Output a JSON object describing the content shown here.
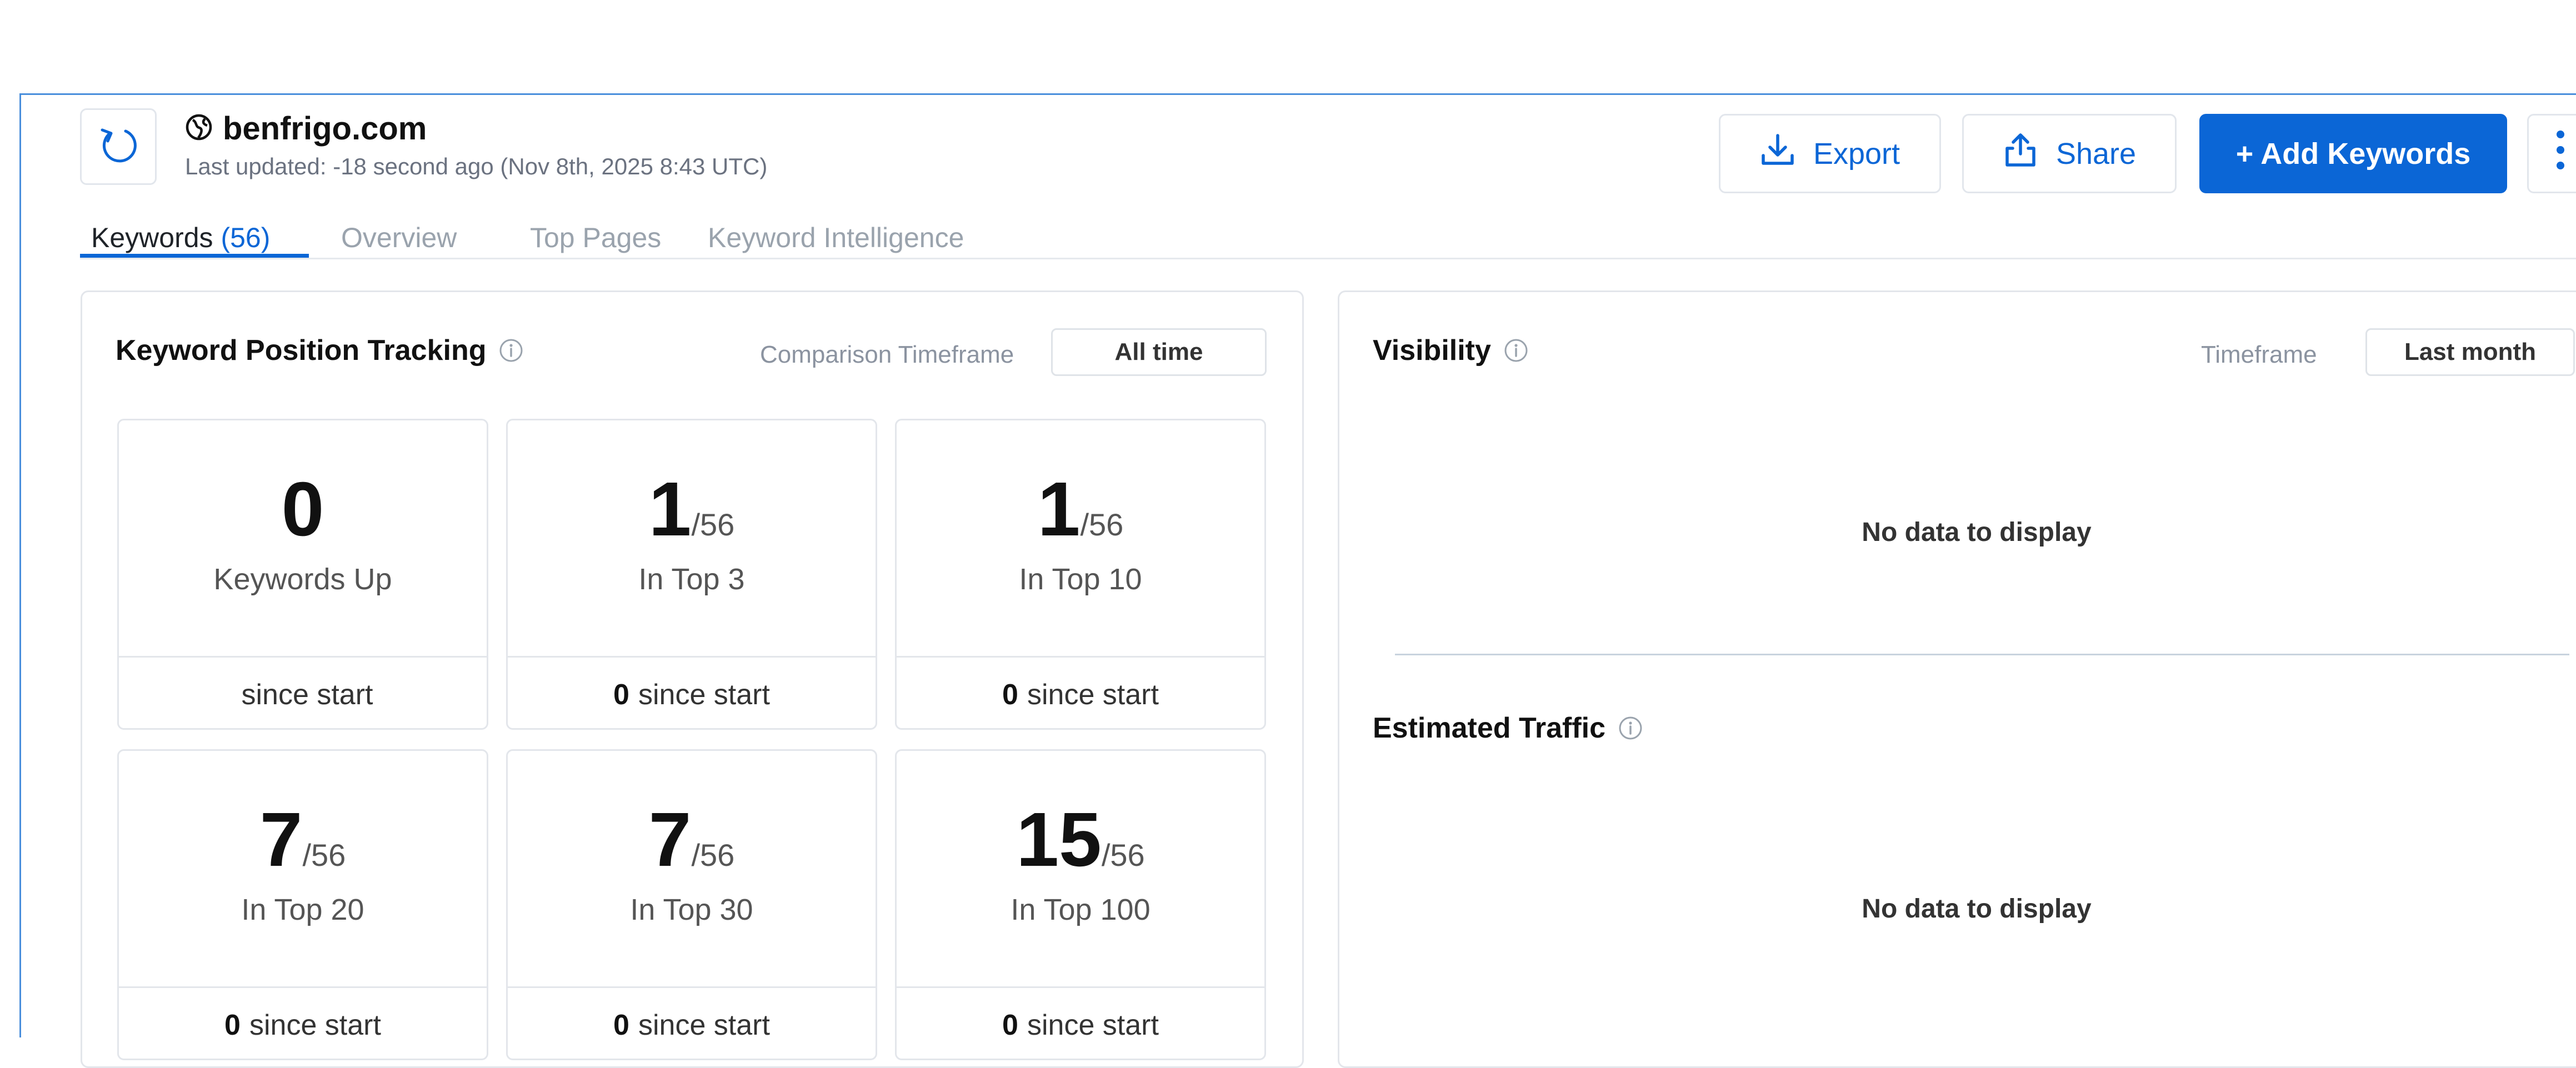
{
  "header": {
    "site_name": "benfrigo.com",
    "last_updated": "Last updated: -18 second ago (Nov 8th, 2025 8:43 UTC)",
    "export_label": "Export",
    "share_label": "Share",
    "add_keywords_label": "+ Add Keywords"
  },
  "tabs": [
    {
      "label": "Keywords",
      "count": "(56)"
    },
    {
      "label": "Overview"
    },
    {
      "label": "Top Pages"
    },
    {
      "label": "Keyword Intelligence"
    }
  ],
  "kpt": {
    "title": "Keyword Position Tracking",
    "timeframe_label": "Comparison Timeframe",
    "timeframe_value": "All time",
    "tiles": [
      {
        "value": "0",
        "denom": "",
        "label": "Keywords Up",
        "change": "",
        "suffix": "since start"
      },
      {
        "value": "1",
        "denom": "/56",
        "label": "In Top 3",
        "change": "0",
        "suffix": "since start"
      },
      {
        "value": "1",
        "denom": "/56",
        "label": "In Top 10",
        "change": "0",
        "suffix": "since start"
      },
      {
        "value": "7",
        "denom": "/56",
        "label": "In Top 20",
        "change": "0",
        "suffix": "since start"
      },
      {
        "value": "7",
        "denom": "/56",
        "label": "In Top 30",
        "change": "0",
        "suffix": "since start"
      },
      {
        "value": "15",
        "denom": "/56",
        "label": "In Top 100",
        "change": "0",
        "suffix": "since start"
      }
    ]
  },
  "visibility": {
    "title": "Visibility",
    "timeframe_label": "Timeframe",
    "timeframe_value": "Last month",
    "empty": "No data to display"
  },
  "traffic": {
    "title": "Estimated Traffic",
    "empty": "No data to display"
  },
  "colors": {
    "accent": "#0b66d6",
    "frame_border": "#4a8fdc"
  },
  "icons": {
    "refresh": "refresh-icon",
    "site": "globe-icon",
    "export": "download-icon",
    "share": "share-icon",
    "more": "kebab-menu-icon",
    "info": "info-icon"
  }
}
